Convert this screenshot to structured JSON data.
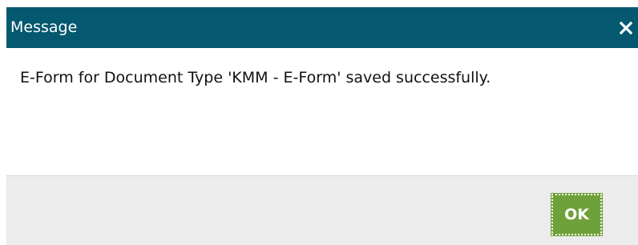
{
  "dialog": {
    "title": "Message",
    "close_icon": "close-icon",
    "message": "E-Form for Document Type 'KMM - E-Form' saved successfully.",
    "ok_label": "OK"
  },
  "colors": {
    "titlebar": "#04586f",
    "footer": "#ececec",
    "ok_button": "#6fa13a"
  }
}
